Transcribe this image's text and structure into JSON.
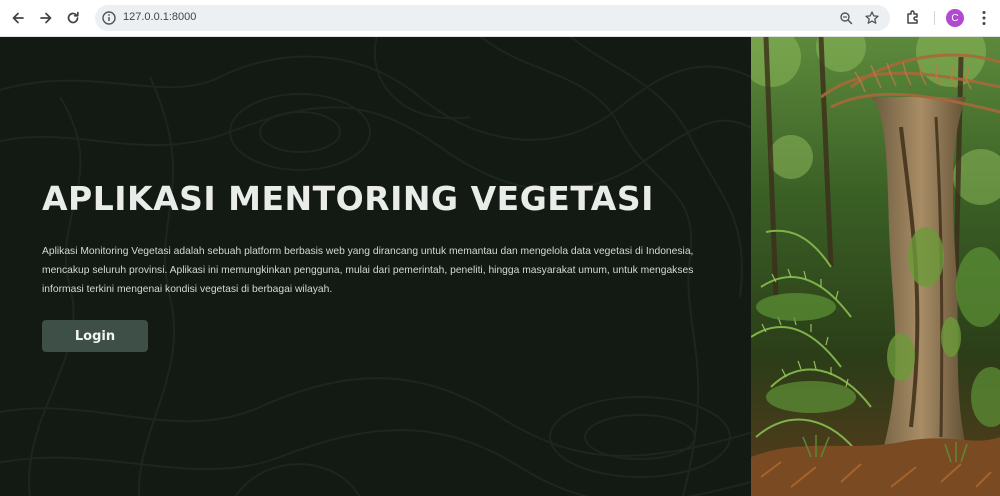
{
  "browser": {
    "url": "127.0.0.1:8000",
    "profile_initial": "C",
    "icons": [
      "back-arrow-icon",
      "forward-arrow-icon",
      "reload-icon",
      "site-info-icon",
      "zoom-icon",
      "bookmark-star-icon",
      "extensions-icon",
      "kebab-menu-icon"
    ]
  },
  "hero": {
    "title": "APLIKASI MENTORING VEGETASI",
    "description": "Aplikasi Monitoring Vegetasi adalah sebuah platform berbasis web yang dirancang untuk memantau dan mengelola data vegetasi di Indonesia, mencakup seluruh provinsi. Aplikasi ini memungkinkan pengguna, mulai dari pemerintah, peneliti, hingga masyarakat umum, untuk mengakses informasi terkini mengenai kondisi vegetasi di berbagai wilayah.",
    "login_label": "Login"
  },
  "colors": {
    "hero_bg": "#121a13",
    "button_bg": "#3d4f47",
    "avatar_bg": "#b14ad1"
  }
}
